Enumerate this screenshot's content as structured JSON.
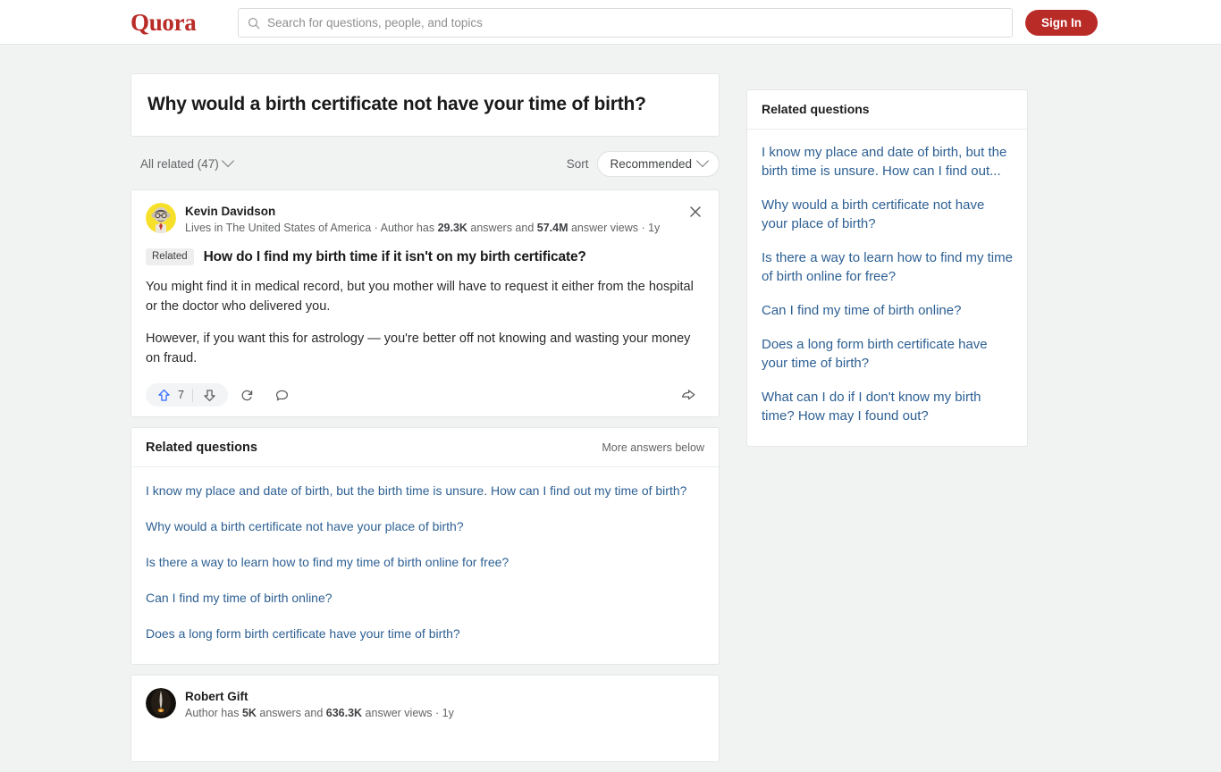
{
  "header": {
    "logo": "Quora",
    "search": {
      "placeholder": "Search for questions, people, and topics",
      "value": "",
      "icon": "search-icon"
    },
    "sign_in_label": "Sign In"
  },
  "question": {
    "title": "Why would a birth certificate not have your time of birth?",
    "all_related_label": "All related (47)",
    "sort_label": "Sort",
    "sort_value": "Recommended"
  },
  "answers": [
    {
      "author": "Kevin Davidson",
      "credential_prefix": "Lives in The United States of America · Author has ",
      "answers_count": "29.3K",
      "credential_mid": " answers and ",
      "views_count": "57.4M",
      "credential_suffix": " answer views · 1y",
      "related_badge": "Related",
      "related_question": "How do I find my birth time if it isn't on my birth certificate?",
      "paragraphs": [
        "You might find it in medical record, but you mother will have to request it either from the hospital or the doctor who delivered you.",
        "However, if you want this for astrology — you're better off not knowing and wasting your money on fraud."
      ],
      "upvote_count": "7",
      "close_icon": "close-icon",
      "upvote_icon": "upvote-arrow-icon",
      "downvote_icon": "downvote-arrow-icon",
      "repost_icon": "repost-icon",
      "comment_icon": "comment-bubble-icon",
      "share_icon": "share-arrow-icon"
    },
    {
      "author": "Robert Gift",
      "credential_prefix": "Author has ",
      "answers_count": "5K",
      "credential_mid": " answers and ",
      "views_count": "636.3K",
      "credential_suffix": " answer views · 1y",
      "paragraphs": []
    }
  ],
  "related_questions_main": {
    "title": "Related questions",
    "more_label": "More answers below",
    "items": [
      "I know my place and date of birth, but the birth time is unsure. How can I find out my time of birth?",
      "Why would a birth certificate not have your place of birth?",
      "Is there a way to learn how to find my time of birth online for free?",
      "Can I find my time of birth online?",
      "Does a long form birth certificate have your time of birth?"
    ]
  },
  "related_questions_sidebar": {
    "title": "Related questions",
    "items": [
      "I know my place and date of birth, but the birth time is unsure. How can I find out...",
      "Why would a birth certificate not have your place of birth?",
      "Is there a way to learn how to find my time of birth online for free?",
      "Can I find my time of birth online?",
      "Does a long form birth certificate have your time of birth?",
      "What can I do if I don't know my birth time? How may I found out?"
    ]
  },
  "colors": {
    "brand": "#b92b27",
    "link": "#2e6093",
    "upvote": "#2e69ff",
    "page_background": "#f1f2f2"
  }
}
